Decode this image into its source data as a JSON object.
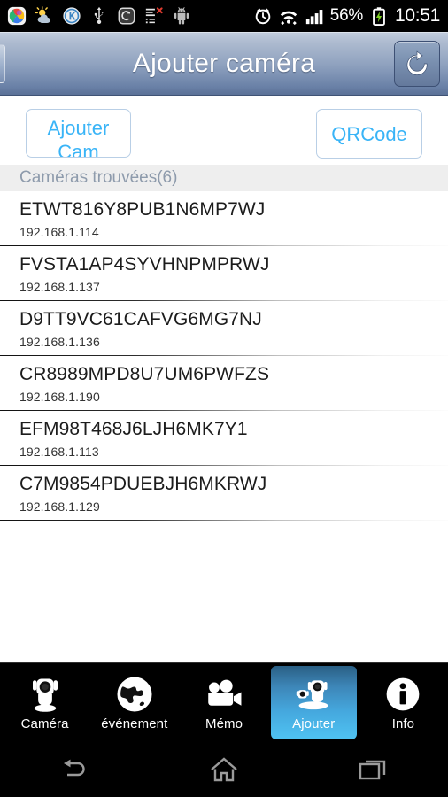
{
  "statusbar": {
    "left_icons": [
      {
        "name": "photos-app-icon"
      },
      {
        "name": "weather-icon"
      },
      {
        "name": "kakao-k-icon"
      },
      {
        "name": "usb-icon"
      },
      {
        "name": "app-badge-icon"
      },
      {
        "name": "task-list-error-icon"
      },
      {
        "name": "android-robot-icon"
      }
    ],
    "right_icons": [
      {
        "name": "alarm-clock-icon"
      },
      {
        "name": "wifi-icon"
      },
      {
        "name": "signal-bars-icon"
      }
    ],
    "battery_percent": "56%",
    "battery_icon": "battery-charging-icon",
    "time": "10:51"
  },
  "titlebar": {
    "title": "Ajouter caméra",
    "back_button_name": "back-button",
    "refresh_icon": "refresh-icon"
  },
  "actions": {
    "add_cam_label": "Ajouter Cam",
    "qrcode_label": "QRCode"
  },
  "list": {
    "header": "Caméras trouvées(6)",
    "rows": [
      {
        "uid": "ETWT816Y8PUB1N6MP7WJ",
        "ip": "192.168.1.114"
      },
      {
        "uid": "FVSTA1AP4SYVHNPMPRWJ",
        "ip": "192.168.1.137"
      },
      {
        "uid": "D9TT9VC61CAFVG6MG7NJ",
        "ip": "192.168.1.136"
      },
      {
        "uid": "CR8989MPD8U7UM6PWFZS",
        "ip": "192.168.1.190"
      },
      {
        "uid": "EFM98T468J6LJH6MK7Y1",
        "ip": "192.168.1.113"
      },
      {
        "uid": "C7M9854PDUEBJH6MKRWJ",
        "ip": "192.168.1.129"
      }
    ]
  },
  "tabbar": {
    "items": [
      {
        "label": "Caméra",
        "icon": "camera-icon",
        "selected": false
      },
      {
        "label": "événement",
        "icon": "globe-icon",
        "selected": false
      },
      {
        "label": "Mémo",
        "icon": "camcorder-icon",
        "selected": false
      },
      {
        "label": "Ajouter",
        "icon": "add-camera-icon",
        "selected": true
      },
      {
        "label": "Info",
        "icon": "info-icon",
        "selected": false
      }
    ]
  },
  "navbar": {
    "back": "nav-back-icon",
    "home": "nav-home-icon",
    "recents": "nav-recents-icon"
  },
  "colors": {
    "accent_blue": "#39b4f7",
    "titlebar_top": "#c2cddd",
    "titlebar_bottom": "#5b7197",
    "selected_tab_bottom": "#4fc3f2",
    "header_bg": "#eeeeee"
  }
}
